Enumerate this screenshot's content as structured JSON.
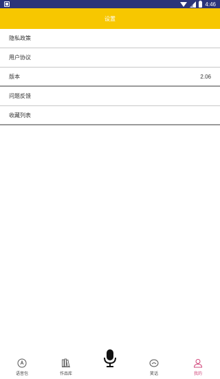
{
  "status_bar": {
    "time": "4:46"
  },
  "header": {
    "title": "设置"
  },
  "menu": {
    "items": [
      {
        "label": "隐私政策",
        "value": ""
      },
      {
        "label": "用户协议",
        "value": ""
      },
      {
        "label": "版本",
        "value": "2.06"
      },
      {
        "label": "问题反馈",
        "value": ""
      },
      {
        "label": "收藏列表",
        "value": ""
      }
    ]
  },
  "bottom_nav": {
    "items": [
      {
        "label": "语音包",
        "icon": "voice-pack-icon"
      },
      {
        "label": "作品库",
        "icon": "library-icon"
      },
      {
        "label": "",
        "icon": "microphone-icon"
      },
      {
        "label": "笑话",
        "icon": "joke-icon"
      },
      {
        "label": "我的",
        "icon": "profile-icon"
      }
    ],
    "active_color": "#d0467a"
  },
  "colors": {
    "status_bar": "#2c3579",
    "accent": "#f7c700"
  }
}
